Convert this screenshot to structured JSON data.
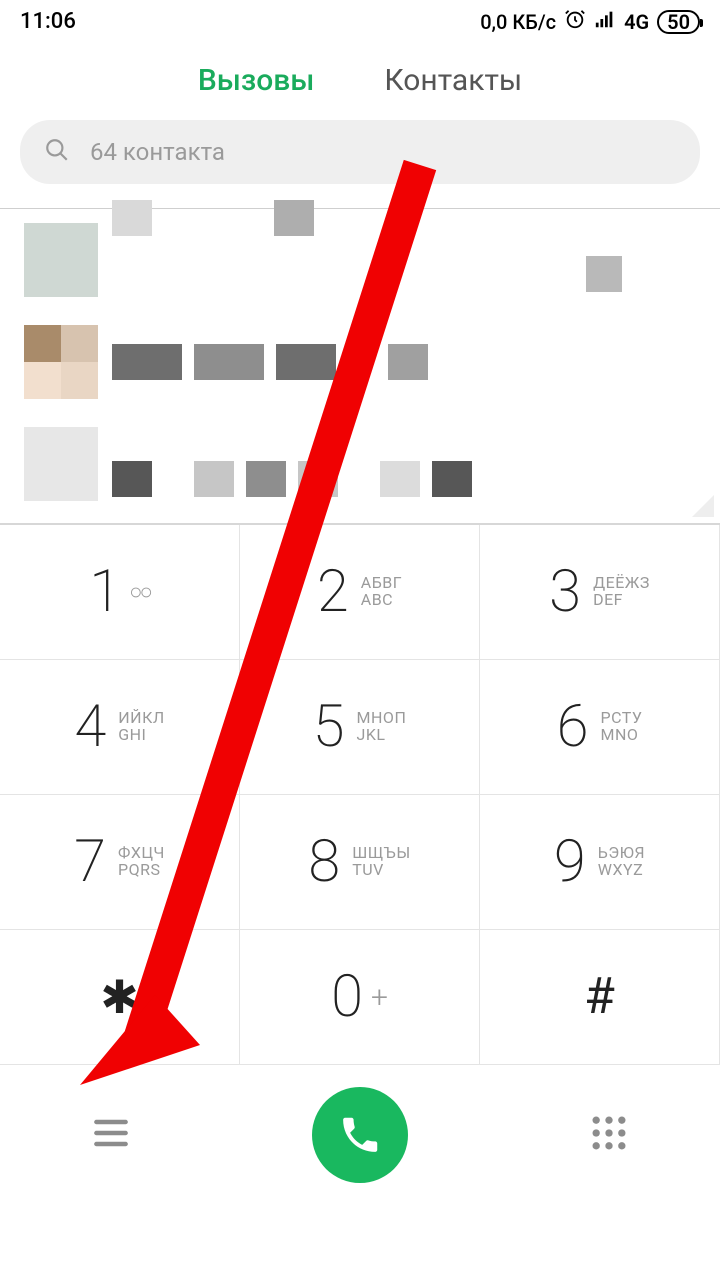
{
  "status": {
    "time": "11:06",
    "data_rate": "0,0 КБ/с",
    "network": "4G",
    "battery": "50"
  },
  "tabs": {
    "calls": "Вызовы",
    "contacts": "Контакты"
  },
  "search": {
    "placeholder": "64 контакта"
  },
  "dialpad": {
    "k1": {
      "d": "1",
      "sym": "∞"
    },
    "k2": {
      "d": "2",
      "ru": "АБВГ",
      "en": "ABC"
    },
    "k3": {
      "d": "3",
      "ru": "ДЕЁЖЗ",
      "en": "DEF"
    },
    "k4": {
      "d": "4",
      "ru": "ИЙКЛ",
      "en": "GHI"
    },
    "k5": {
      "d": "5",
      "ru": "МНОП",
      "en": "JKL"
    },
    "k6": {
      "d": "6",
      "ru": "РСТУ",
      "en": "MNO"
    },
    "k7": {
      "d": "7",
      "ru": "ФХЦЧ",
      "en": "PQRS"
    },
    "k8": {
      "d": "8",
      "ru": "ШЩЪЫ",
      "en": "TUV"
    },
    "k9": {
      "d": "9",
      "ru": "ЬЭЮЯ",
      "en": "WXYZ"
    },
    "kstar": {
      "d": "✱"
    },
    "k0": {
      "d": "0",
      "plus": "+"
    },
    "khash": {
      "d": "#"
    }
  },
  "colors": {
    "accent": "#19b85f",
    "arrow": "#f00102"
  }
}
